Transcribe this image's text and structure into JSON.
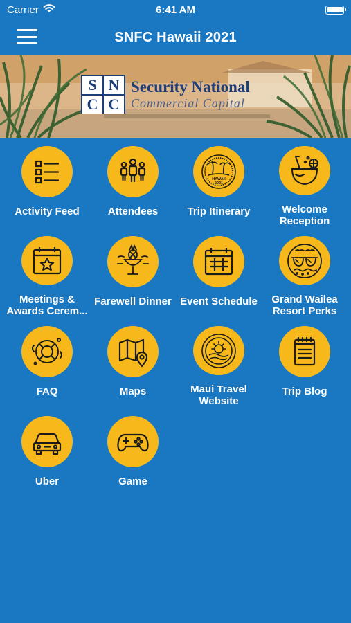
{
  "status_bar": {
    "carrier": "Carrier",
    "time": "6:41 AM"
  },
  "nav": {
    "title": "SNFC Hawaii 2021"
  },
  "banner": {
    "logo_mark": [
      "S",
      "N",
      "C",
      "C"
    ],
    "line1": "Security National",
    "line2": "Commercial Capital"
  },
  "tiles": [
    {
      "label": "Activity Feed",
      "icon": "list-icon"
    },
    {
      "label": "Attendees",
      "icon": "people-icon"
    },
    {
      "label": "Trip Itinerary",
      "icon": "hawaii-2021-badge-icon",
      "badge_text": "HAWAII 2021"
    },
    {
      "label": "Welcome Reception",
      "icon": "coconut-drink-icon"
    },
    {
      "label": "Meetings & Awards Cerem...",
      "icon": "calendar-star-icon"
    },
    {
      "label": "Farewell Dinner",
      "icon": "pineapple-cocktail-icon"
    },
    {
      "label": "Event Schedule",
      "icon": "calendar-grid-icon"
    },
    {
      "label": "Grand Wailea Resort Perks",
      "icon": "sunglasses-icon"
    },
    {
      "label": "FAQ",
      "icon": "lifebuoy-icon"
    },
    {
      "label": "Maps",
      "icon": "map-icon"
    },
    {
      "label": "Maui Travel Website",
      "icon": "sun-seal-icon"
    },
    {
      "label": "Trip Blog",
      "icon": "notepad-icon"
    },
    {
      "label": "Uber",
      "icon": "car-icon"
    },
    {
      "label": "Game",
      "icon": "gamepad-icon"
    }
  ],
  "colors": {
    "background": "#1a78c2",
    "icon_circle": "#f6b81b",
    "icon_stroke": "#1b1b1b"
  }
}
